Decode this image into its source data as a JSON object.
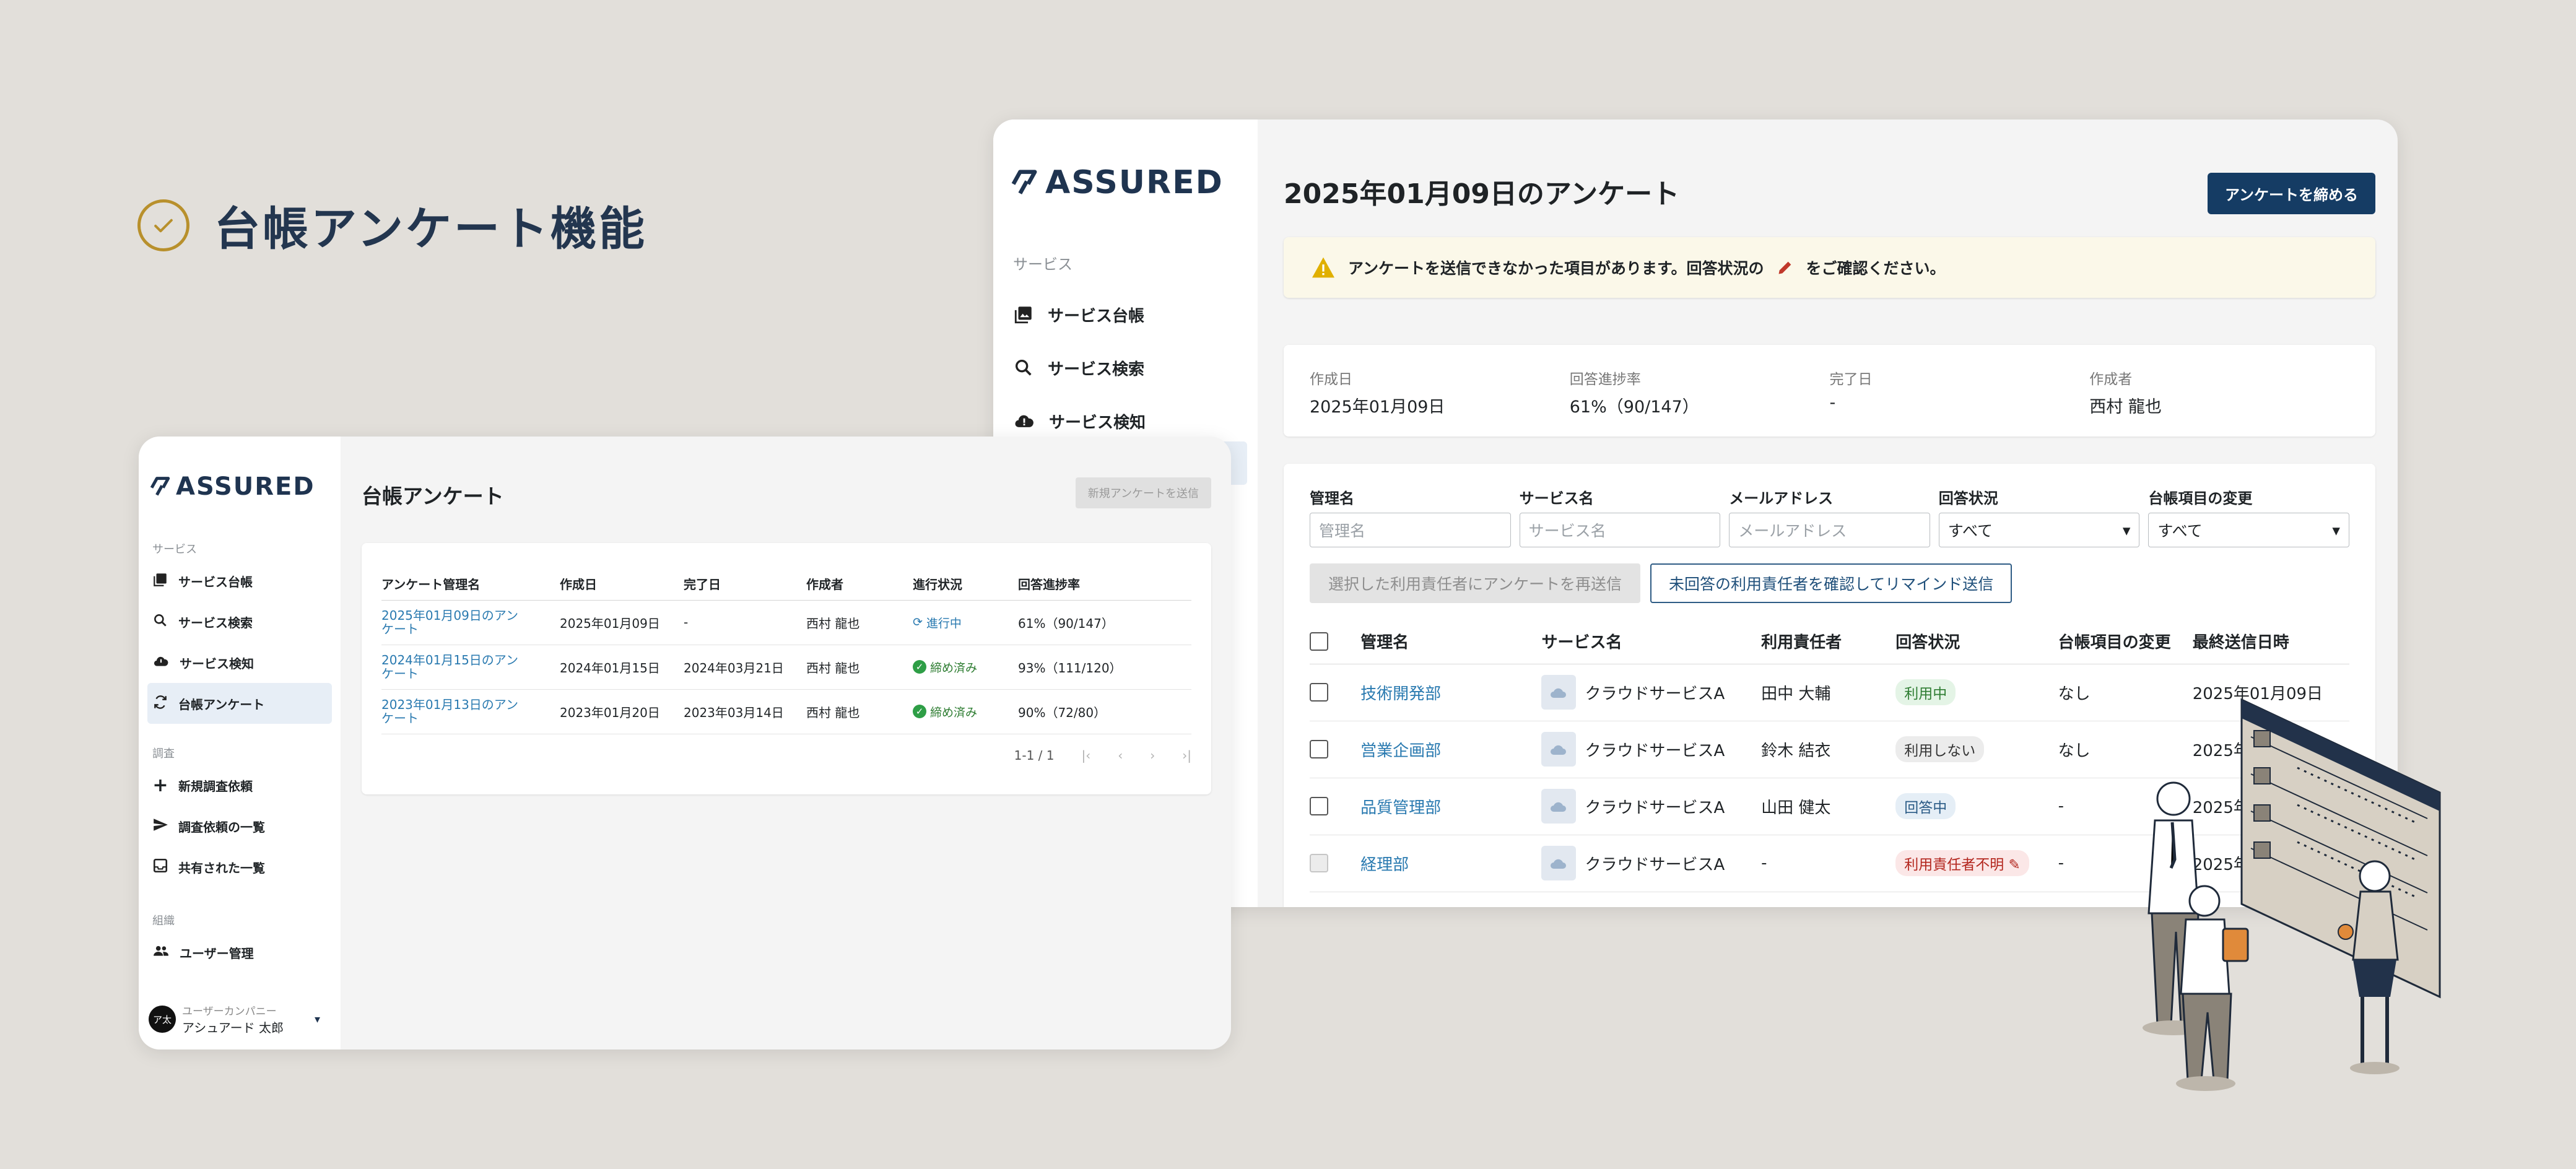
{
  "headline": {
    "title": "台帳アンケート機能"
  },
  "brand": {
    "name": "ASSURED",
    "accent": "#153c64",
    "headline_color": "#23364f",
    "check_color": "#b8902c"
  },
  "right_window": {
    "sidebar": {
      "section": "サービス",
      "items": [
        {
          "label": "サービス台帳",
          "icon": "photo-library-icon"
        },
        {
          "label": "サービス検索",
          "icon": "search-icon"
        },
        {
          "label": "サービス検知",
          "icon": "cloud-alert-icon"
        }
      ]
    },
    "title": "2025年01月09日のアンケート",
    "close_button": "アンケートを締める",
    "alert": {
      "text_before": "アンケートを送信できなかった項目があります。回答状況の",
      "text_after": "をご確認ください。"
    },
    "meta": [
      {
        "label": "作成日",
        "value": "2025年01月09日"
      },
      {
        "label": "回答進捗率",
        "value": "61%（90/147）"
      },
      {
        "label": "完了日",
        "value": "-"
      },
      {
        "label": "作成者",
        "value": "西村 龍也"
      }
    ],
    "filters": [
      {
        "label": "管理名",
        "placeholder": "管理名"
      },
      {
        "label": "サービス名",
        "placeholder": "サービス名"
      },
      {
        "label": "メールアドレス",
        "placeholder": "メールアドレス"
      },
      {
        "label": "回答状況",
        "value": "すべて"
      },
      {
        "label": "台帳項目の変更",
        "value": "すべて"
      }
    ],
    "resend_button": "選択した利用責任者にアンケートを再送信",
    "remind_button": "未回答の利用責任者を確認してリマインド送信",
    "columns": [
      "管理名",
      "サービス名",
      "利用責任者",
      "回答状況",
      "台帳項目の変更",
      "最終送信日時"
    ],
    "rows": [
      {
        "dept": "技術開発部",
        "service": "クラウドサービスA",
        "owner": "田中 大輔",
        "status": "利用中",
        "change": "なし",
        "sent": "2025年01月09日"
      },
      {
        "dept": "営業企画部",
        "service": "クラウドサービスA",
        "owner": "鈴木 結衣",
        "status": "利用しない",
        "change": "なし",
        "sent": "2025年01月09日"
      },
      {
        "dept": "品質管理部",
        "service": "クラウドサービスA",
        "owner": "山田 健太",
        "status": "回答中",
        "change": "-",
        "sent": "2025年01月09日"
      },
      {
        "dept": "経理部",
        "service": "クラウドサービスA",
        "owner": "-",
        "status": "利用責任者不明",
        "change": "-",
        "sent": "2025年01月09日"
      }
    ]
  },
  "left_window": {
    "sidebar": {
      "sections": [
        {
          "label": "サービス",
          "items": [
            "サービス台帳",
            "サービス検索",
            "サービス検知",
            "台帳アンケート"
          ]
        },
        {
          "label": "調査",
          "items": [
            "新規調査依頼",
            "調査依頼の一覧",
            "共有された一覧"
          ]
        },
        {
          "label": "組織",
          "items": [
            "ユーザー管理"
          ]
        }
      ],
      "user": {
        "avatar": "ア太",
        "company": "ユーザーカンパニー",
        "name": "アシュアード 太郎"
      }
    },
    "title": "台帳アンケート",
    "new_button": "新規アンケートを送信",
    "columns": [
      "アンケート管理名",
      "作成日",
      "完了日",
      "作成者",
      "進行状況",
      "回答進捗率"
    ],
    "rows": [
      {
        "name": "2025年01月09日のアンケート",
        "created": "2025年01月09日",
        "done": "-",
        "author": "西村 龍也",
        "status": "進行中",
        "rate": "61%（90/147）"
      },
      {
        "name": "2024年01月15日のアンケート",
        "created": "2024年01月15日",
        "done": "2024年03月21日",
        "author": "西村 龍也",
        "status": "締め済み",
        "rate": "93%（111/120）"
      },
      {
        "name": "2023年01月13日のアンケート",
        "created": "2023年01月20日",
        "done": "2023年03月14日",
        "author": "西村 龍也",
        "status": "締め済み",
        "rate": "90%（72/80）"
      }
    ],
    "pager": "1-1 / 1"
  }
}
